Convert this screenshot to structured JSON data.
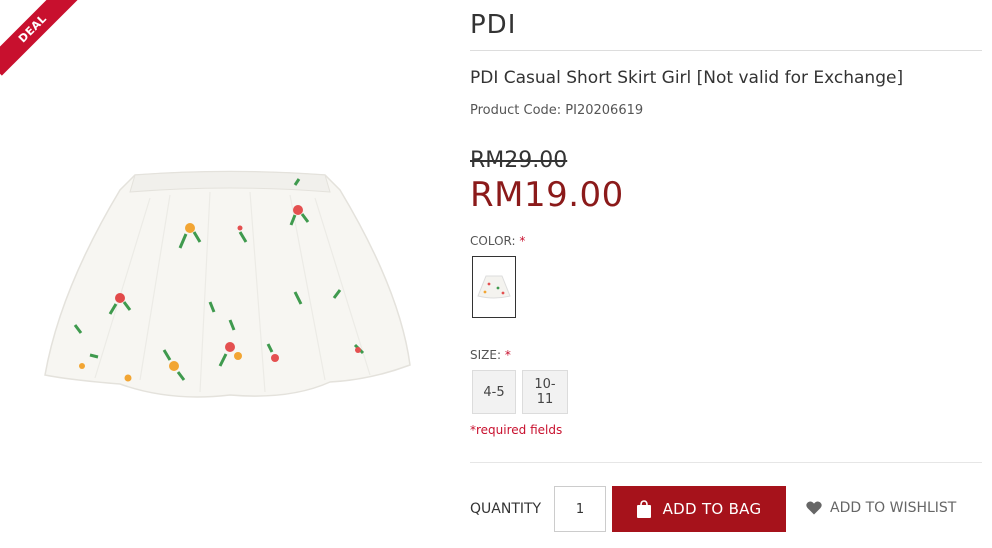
{
  "badge": {
    "label": "DEAL",
    "color": "#c8102e"
  },
  "product": {
    "brand": "PDI",
    "name": "PDI Casual Short Skirt Girl [Not valid for Exchange]",
    "code": "Product Code: PI20206619",
    "original_price": "RM29.00",
    "sale_price": "RM19.00"
  },
  "options": {
    "color_label": "COLOR:",
    "required_mark": "*",
    "size_label": "SIZE:",
    "sizes": [
      "4-5",
      "10-11"
    ],
    "required_note": "*required fields"
  },
  "actions": {
    "quantity_label": "QUANTITY",
    "quantity_value": "1",
    "add_to_bag": "ADD TO BAG",
    "add_to_wishlist": "ADD TO WISHLIST"
  },
  "colors": {
    "accent": "#a6121b",
    "price": "#8b1a1a",
    "required": "#c8102e"
  },
  "icons": {
    "bag": "shopping-bag-icon",
    "wishlist": "heart-icon"
  }
}
